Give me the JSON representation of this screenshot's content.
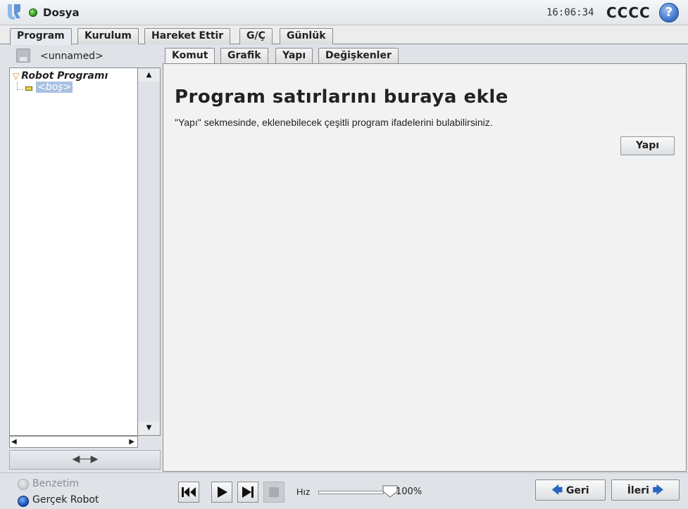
{
  "header": {
    "title": "Dosya",
    "clock": "16:06:34",
    "robot_name": "CCCC",
    "help_glyph": "?",
    "status_color": "#2f9a1c"
  },
  "main_tabs": [
    {
      "label": "Program",
      "active": true
    },
    {
      "label": "Kurulum",
      "active": false
    },
    {
      "label": "Hareket Ettir",
      "active": false
    },
    {
      "label": "G/Ç",
      "active": false
    },
    {
      "label": "Günlük",
      "active": false
    }
  ],
  "left_panel": {
    "file_name": "<unnamed>",
    "tree": {
      "root_label": "Robot Programı",
      "child_label": "<boş>"
    }
  },
  "sub_tabs": [
    {
      "label": "Komut",
      "active": true
    },
    {
      "label": "Grafik",
      "active": false
    },
    {
      "label": "Yapı",
      "active": false
    },
    {
      "label": "Değişkenler",
      "active": false
    }
  ],
  "content": {
    "heading": "Program satırlarını buraya ekle",
    "description": "\"Yapı\" sekmesinde, eklenebilecek çeşitli program ifadelerini bulabilirsiniz.",
    "structure_button": "Yapı"
  },
  "bottom": {
    "mode_simulation": "Benzetim",
    "mode_real": "Gerçek Robot",
    "speed_label": "Hız",
    "speed_value": "100%",
    "speed_fraction": 1.0,
    "back_button": "Geri",
    "next_button": "İleri"
  }
}
